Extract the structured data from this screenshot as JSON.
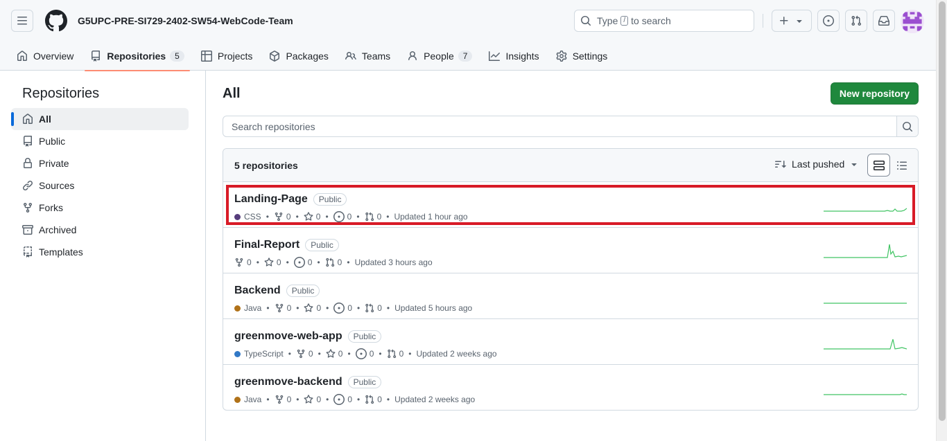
{
  "header": {
    "org_name": "G5UPC-PRE-SI729-2402-SW54-WebCode-Team",
    "search_prefix": "Type",
    "search_key": "/",
    "search_suffix": "to search"
  },
  "tabs": [
    {
      "label": "Overview",
      "icon": "home-icon"
    },
    {
      "label": "Repositories",
      "icon": "repo-icon",
      "count": "5",
      "selected": true
    },
    {
      "label": "Projects",
      "icon": "table-icon"
    },
    {
      "label": "Packages",
      "icon": "package-icon"
    },
    {
      "label": "Teams",
      "icon": "people-icon"
    },
    {
      "label": "People",
      "icon": "person-icon",
      "count": "7"
    },
    {
      "label": "Insights",
      "icon": "graph-icon"
    },
    {
      "label": "Settings",
      "icon": "gear-icon"
    }
  ],
  "sidebar": {
    "title": "Repositories",
    "items": [
      {
        "label": "All",
        "selected": true
      },
      {
        "label": "Public"
      },
      {
        "label": "Private"
      },
      {
        "label": "Sources"
      },
      {
        "label": "Forks"
      },
      {
        "label": "Archived"
      },
      {
        "label": "Templates"
      }
    ]
  },
  "main": {
    "title": "All",
    "new_button": "New repository",
    "search_placeholder": "Search repositories",
    "count_label": "5 repositories",
    "sort_label": "Last pushed"
  },
  "repos": [
    {
      "name": "Landing-Page",
      "visibility": "Public",
      "language": "CSS",
      "lang_color": "#563d7c",
      "forks": "0",
      "stars": "0",
      "issues": "0",
      "prs": "0",
      "updated": "Updated 1 hour ago",
      "highlighted": true
    },
    {
      "name": "Final-Report",
      "visibility": "Public",
      "language": "",
      "lang_color": "",
      "forks": "0",
      "stars": "0",
      "issues": "0",
      "prs": "0",
      "updated": "Updated 3 hours ago"
    },
    {
      "name": "Backend",
      "visibility": "Public",
      "language": "Java",
      "lang_color": "#b07219",
      "forks": "0",
      "stars": "0",
      "issues": "0",
      "prs": "0",
      "updated": "Updated 5 hours ago"
    },
    {
      "name": "greenmove-web-app",
      "visibility": "Public",
      "language": "TypeScript",
      "lang_color": "#3178c6",
      "forks": "0",
      "stars": "0",
      "issues": "0",
      "prs": "0",
      "updated": "Updated 2 weeks ago"
    },
    {
      "name": "greenmove-backend",
      "visibility": "Public",
      "language": "Java",
      "lang_color": "#b07219",
      "forks": "0",
      "stars": "0",
      "issues": "0",
      "prs": "0",
      "updated": "Updated 2 weeks ago"
    }
  ]
}
